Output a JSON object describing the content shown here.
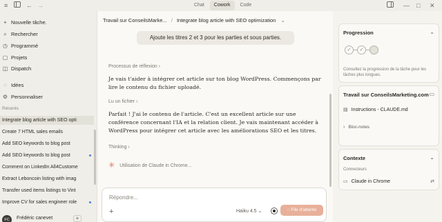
{
  "topbar": {
    "menu_icon": "≡",
    "sidebar_icon": "sidebar-toggle-icon",
    "back_icon": "←",
    "forward_icon": "→",
    "modes": [
      "Chat",
      "Cowork",
      "Code"
    ],
    "active_mode": "Cowork"
  },
  "sidebar": {
    "nav": [
      {
        "icon": "+",
        "label": "Nouvelle tâche."
      },
      {
        "icon": "⌕",
        "label": "Rechercher"
      },
      {
        "icon": "◷",
        "label": "Programmé"
      },
      {
        "icon": "▢",
        "label": "Projets"
      },
      {
        "icon": "◫",
        "label": "Dispatch"
      },
      {
        "icon": "◌",
        "label": "Idées"
      },
      {
        "icon": "⚙",
        "label": "Personnaliser"
      }
    ],
    "recent_heading": "Récents",
    "recents": [
      "Integrate blog article with SEO opti",
      "Create 7 HTML sales emails",
      "Add SEO keywords to blog post",
      "Add SEO keywords to blog post",
      "Comment on LinkedIn All4Custome",
      "Extract Leboncoin listing with imag",
      "Transfer used items listings to Vint",
      "Improve CV for sales engineer role"
    ],
    "user_initials": "FC",
    "user_name": "Frédéric canevet",
    "user_plus": "+"
  },
  "main": {
    "breadcrumb_project": "Travail sur ConseilsMarke...",
    "breadcrumb_task": "Integrate blog article with SEO optimization",
    "user_message": "Ajoute les titres 2 et 3 pour les parties et sous parties.",
    "section1_label": "Processus de réflexion",
    "para1": "Je vais t'aider à intégrer cet article sur ton blog WordPress. Commençons par lire le contenu du fichier uploadé.",
    "section2_label": "Lu un fichier",
    "para2": "Parfait ! J'ai le contenu de l'article. C'est un excellent article sur une conférence concernant l'IA et la relation client. Je vais maintenant accéder à WordPress pour intégrer cet article avec les améliorations SEO et les titres.",
    "section3_label": "Thinking",
    "tool_label": "Utilisation de Claude in Chrome...",
    "composer_placeholder": "Répondre...",
    "model": "Haiku 4.5",
    "send_label": "File d'attente"
  },
  "right": {
    "progress_title": "Progression",
    "progress_steps": 3,
    "progress_completed": 2,
    "progress_note": "Consultez la progression de la tâche pour les tâches plus longues.",
    "workspace_title": "Travail sur ConseilsMarketing.com",
    "file_name": "Instructions - CLAUDE.md",
    "notes_label": "Bloc-notes",
    "context_title": "Contexte",
    "connectors_label": "Connecteurs",
    "connector_name": "Claude in Chrome"
  }
}
